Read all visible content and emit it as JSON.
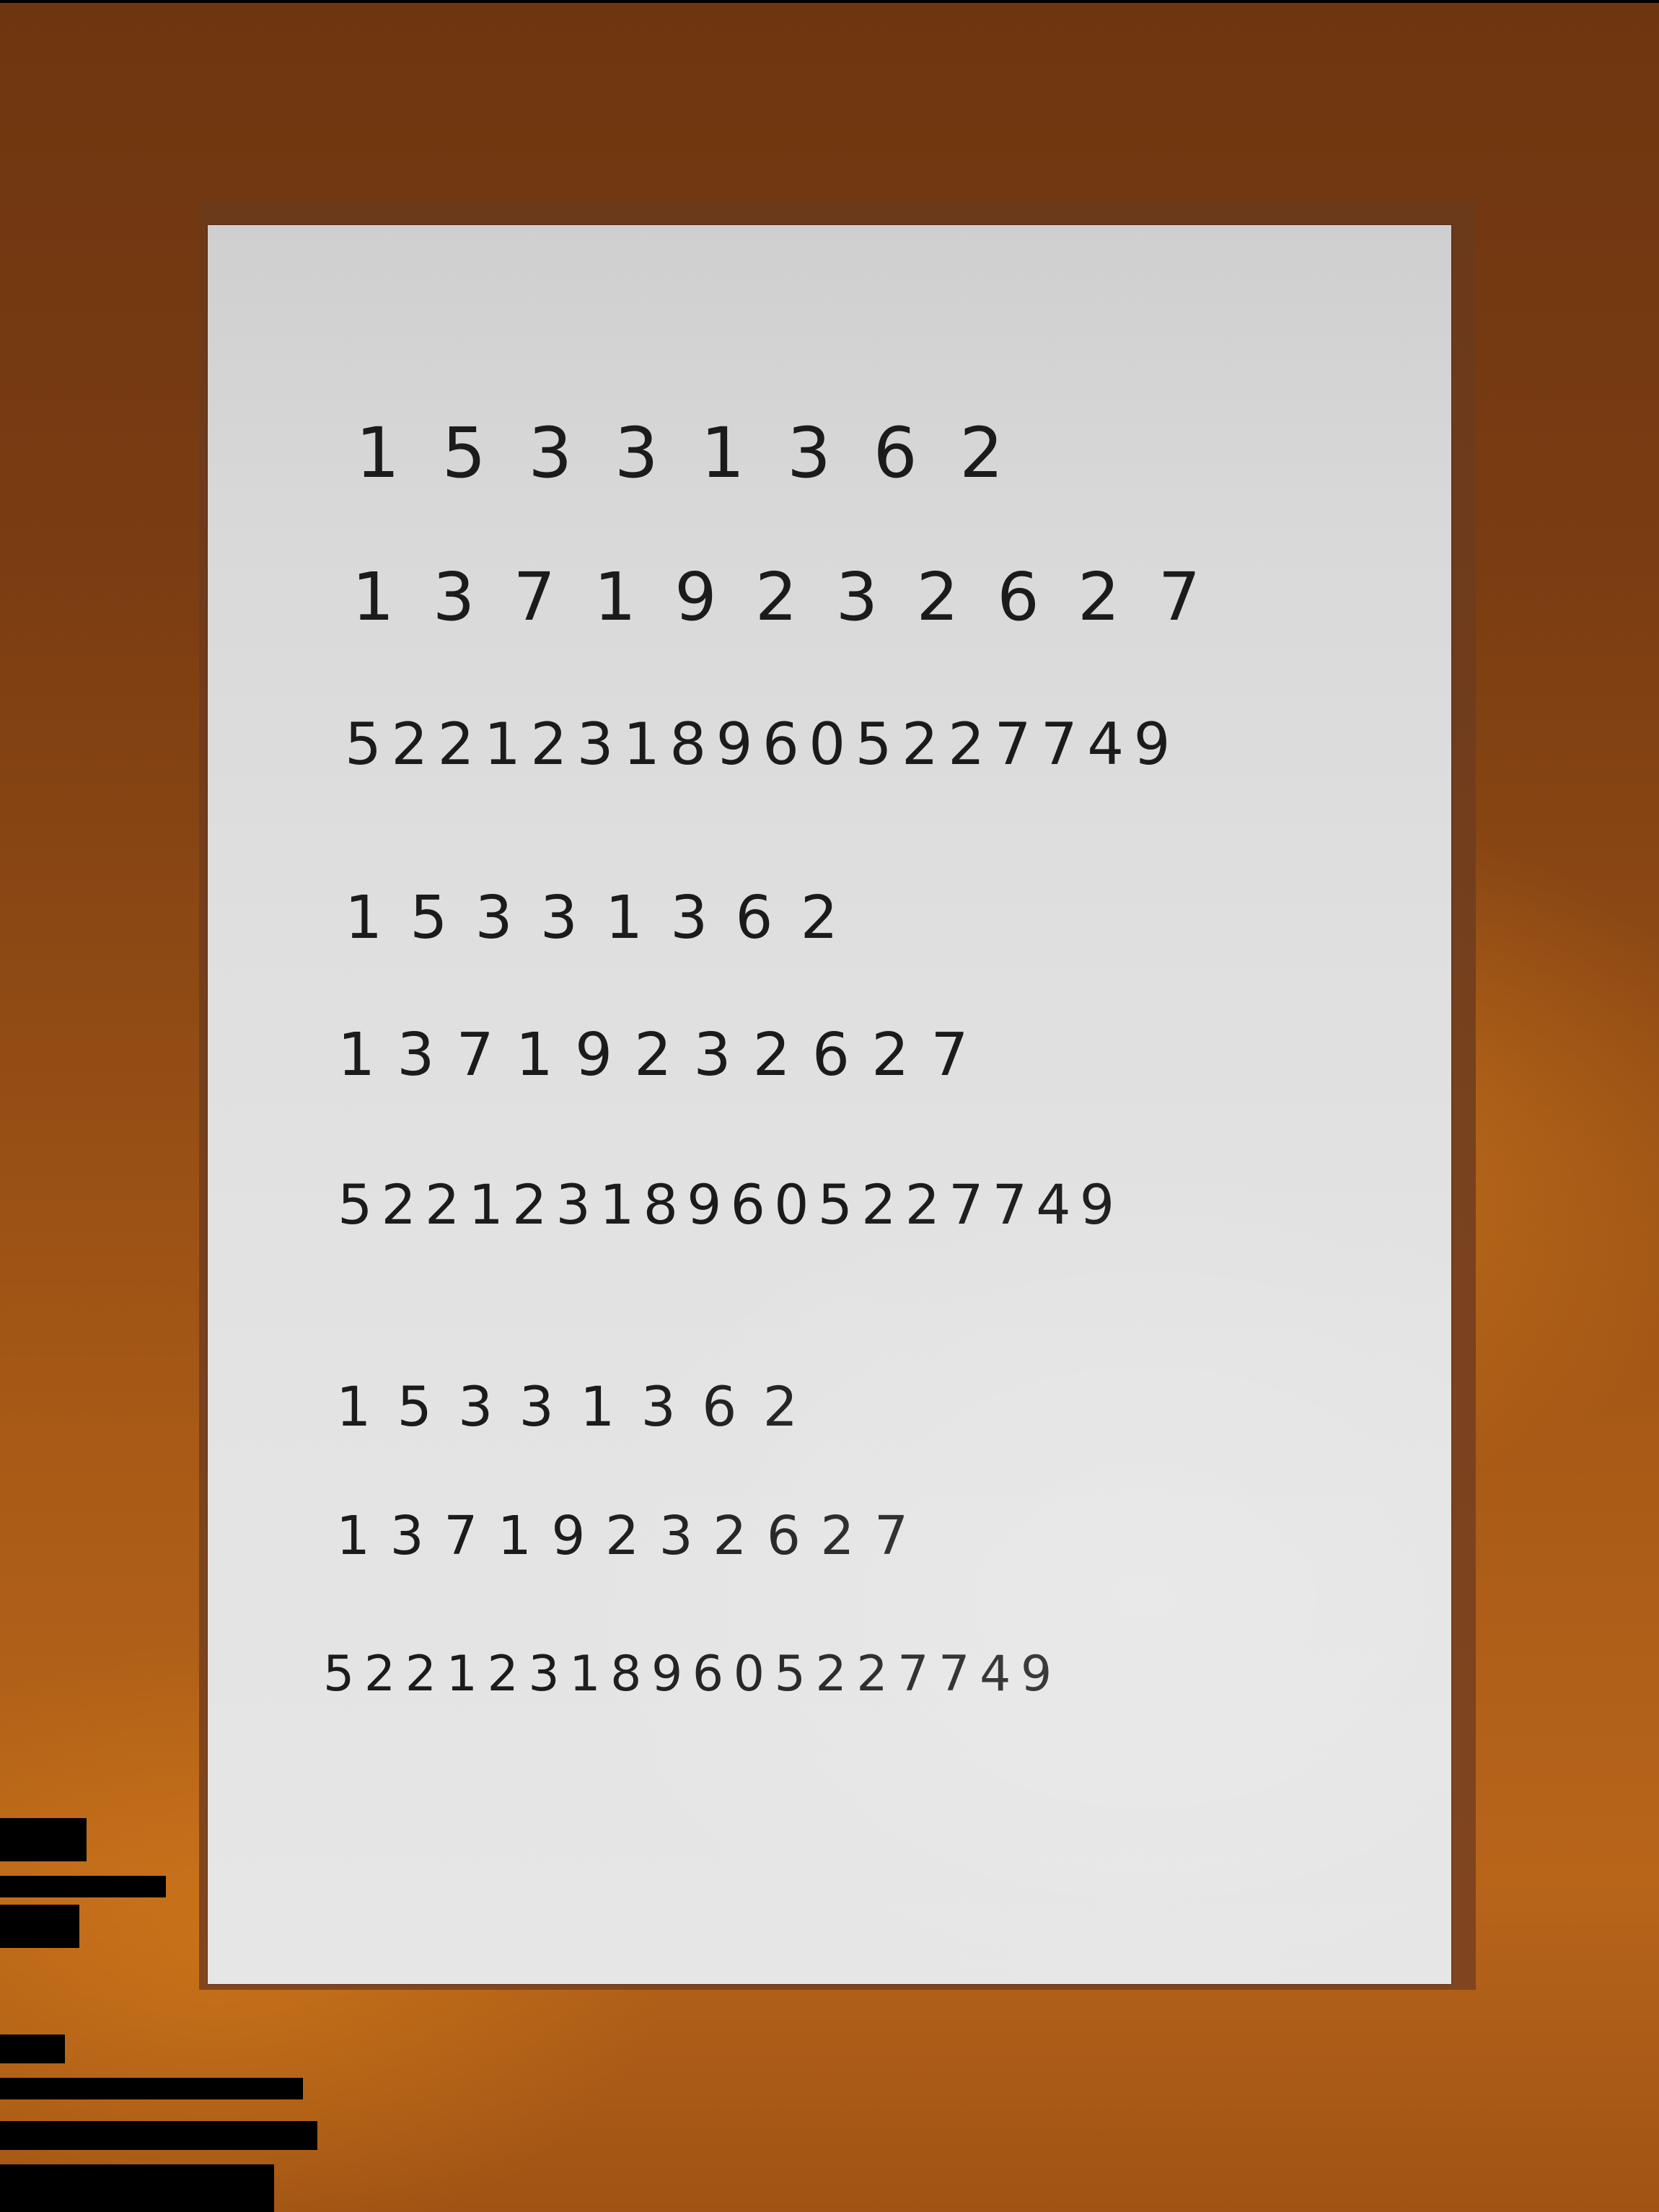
{
  "scene": {
    "description_free": true
  },
  "paper": {
    "lines": [
      "1 5 3 3 1 3 6 2",
      "1 3 7 1 9 2 3 2 6 2 7",
      "5 2 2 1 2 3 1 8 9 6 0 5 2 2 7 7 4 9",
      "1 5 3 3 1 3 6 2",
      "1 3 7 1 9 2 3 2 6 2 7",
      "5 2 2 1 2 3 1 8 9 6 0 5 2 2 7 7 4 9",
      "1 5 3 3 1 3 6 2",
      "1 3 7 1 9 2 3 2 6 2 7",
      "5 2 2 1 2 3 1 8 9 6 0 5 2 2 7 7 4 9"
    ]
  },
  "colors": {
    "table": "#8f4a14",
    "paper": "#dedede",
    "ink": "#1b1b1b"
  }
}
